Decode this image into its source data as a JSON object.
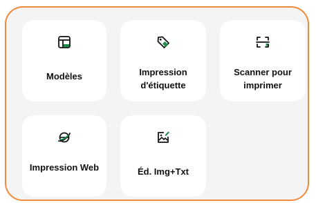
{
  "tiles": [
    {
      "label": "Modèles",
      "icon": "layout-template-icon"
    },
    {
      "label": "Impression d'étiquette",
      "icon": "label-tag-icon"
    },
    {
      "label": "Scanner pour imprimer",
      "icon": "scan-frame-icon"
    },
    {
      "label": "Impression Web",
      "icon": "web-globe-icon"
    },
    {
      "label": "Éd. Img+Txt",
      "icon": "image-edit-icon"
    }
  ],
  "colors": {
    "accent": "#f08a38",
    "icon_accent": "#1f8a4c",
    "panel_bg": "#f4f4f4",
    "tile_bg": "#ffffff",
    "text": "#111111"
  }
}
